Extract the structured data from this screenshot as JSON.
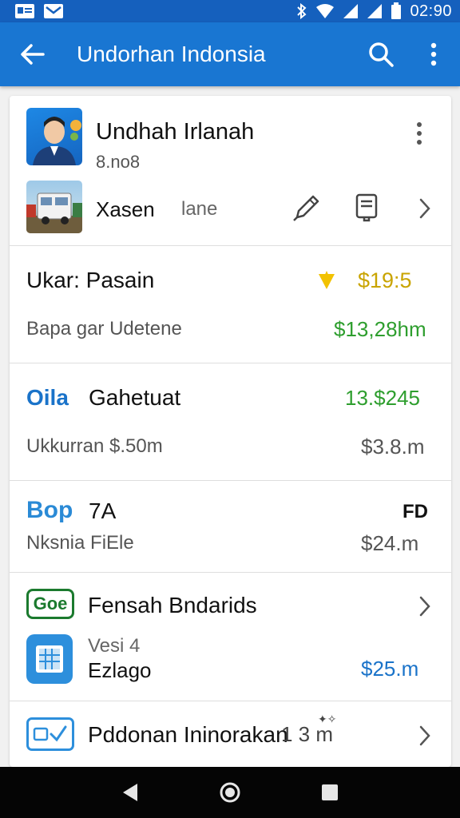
{
  "status_bar": {
    "time": "02:90"
  },
  "app_bar": {
    "title": "Undorhan Indonsia"
  },
  "profile": {
    "name": "Undhah Irlanah",
    "number": "8.no8",
    "label_primary": "Xasen",
    "label_secondary": "lane"
  },
  "rows": [
    {
      "title": "Ukar:  Pasain",
      "amount": "$19:5",
      "sub": "Bapa gar Udetene",
      "sub_amount": "$13,28hm"
    },
    {
      "brand": "Oila",
      "title": "Gahetuat",
      "amount": "13.$245",
      "sub": "Ukkurran $.50m",
      "sub_amount": "$3.8.m"
    },
    {
      "brand": "Bop",
      "title": "7A",
      "amount": "FD",
      "sub": "Nksnia FiEle",
      "sub_amount": "$24.m"
    },
    {
      "badge": "Goe",
      "title": "Fensah Bndarids",
      "sub_small": "Vesi 4",
      "sub": "Ezlago",
      "sub_amount": "$25.m"
    },
    {
      "title": "Pddonan Ininorakan",
      "amount": "1 3 m"
    }
  ],
  "colors": {
    "accent": "#1976d2",
    "status": "#1560bd",
    "green": "#2e9e2e",
    "amber": "#c9a400"
  }
}
